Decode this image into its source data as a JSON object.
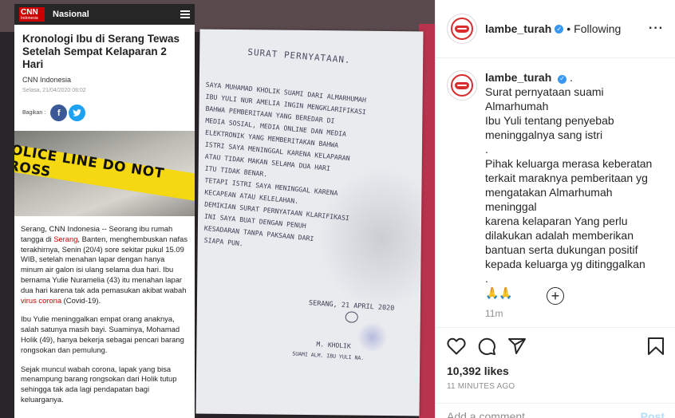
{
  "article": {
    "site": "CNN",
    "site_sub": "Indonesia",
    "section": "Nasional",
    "title": "Kronologi Ibu di Serang Tewas Setelah Sempat Kelaparan 2 Hari",
    "source": "CNN Indonesia",
    "date": "Selasa, 21/04/2020 08:02",
    "share_label": "Bagikan :",
    "tape_text": "POLICE LINE DO NOT CROSS",
    "p1": {
      "a": "Serang, CNN Indonesia -- Seorang ibu rumah tangga di ",
      "b": "Serang",
      "c": ", Banten, menghembuskan nafas terakhirnya, Senin (20/4) sore sekitar pukul 15.09 WIB, setelah menahan lapar dengan hanya minum air galon isi ulang selama dua hari. Ibu bernama Yulie Nuramelia (43) itu menahan lapar dua hari karena tak ada pemasukan akibat wabah ",
      "d": "virus corona",
      "e": " (Covid-19)."
    },
    "p2": "Ibu Yulie meninggalkan empat orang anaknya, salah satunya masih bayi. Suaminya, Mohamad Holik (49), hanya bekerja sebagai pencari barang rongsokan dan pemulung.",
    "p3": "Sejak muncul wabah corona, lapak yang bisa menampung barang rongsokan dari Holik tutup sehingga tak ada lagi pendapatan bagi keluarganya."
  },
  "letter": {
    "title": "SURAT PERNYATAAN.",
    "lines": [
      "SAYA MUHAMAD KHOLIK SUAMI DARI ALMARHUMAH",
      "IBU YULI NUR AMELIA INGIN MENGKLARIFIKASI",
      "BAHWA PEMBERITAAN YANG BEREDAR DI",
      "MEDIA SOSIAL, MEDIA ONLINE DAN MEDIA",
      "ELEKTRONIK YANG MEMBERITAKAN BAHWA",
      "ISTRI SAYA MENINGGAL KARENA KELAPARAN",
      "ATAU TIDAK MAKAN SELAMA DUA HARI",
      "ITU TIDAK BENAR.",
      "TETAPI ISTRI SAYA MENINGGAL KARENA",
      "KECAPEAN ATAU KELELAHAN.",
      "",
      "DEMIKIAN SURAT PERNYATAAN KLARIFIKASI",
      "INI SAYA BUAT DENGAN PENUH",
      "KESADARAN TANPA PAKSAAN DARI",
      "SIAPA PUN."
    ],
    "place_date": "SERANG, 21 APRIL 2020",
    "name": "M. KHOLIK",
    "name_sub": "SUAMI ALM. IBU YULI NA."
  },
  "panel": {
    "username": "lambe_turah",
    "follow_state": "Following",
    "caption_lines": [
      "Surat pernyataan suami Almarhumah",
      "Ibu Yuli tentang penyebab",
      "meninggalnya sang istri",
      ".",
      "Pihak keluarga merasa keberatan",
      "terkait maraknya pemberitaan yg",
      "mengatakan Almarhumah meninggal",
      "karena kelaparan Yang perlu",
      "dilakukan adalah memberikan",
      "bantuan serta dukungan positif",
      "kepada keluarga yg ditinggalkan",
      ".",
      "🙏🙏"
    ],
    "caption_time": "11m",
    "likes": "10,392 likes",
    "time_ago": "11 MINUTES AGO",
    "comment_placeholder": "Add a comment…",
    "post_label": "Post"
  },
  "colors": {
    "cnn_red": "#cc0000",
    "verified_blue": "#3897f0",
    "post_disabled": "#b2dffc",
    "tape_yellow": "#f4d812"
  },
  "icons": [
    "hamburger-icon",
    "facebook-icon",
    "twitter-icon",
    "verified-icon",
    "more-icon",
    "heart-icon",
    "comment-icon",
    "share-icon",
    "bookmark-icon",
    "plus-circle-icon"
  ]
}
